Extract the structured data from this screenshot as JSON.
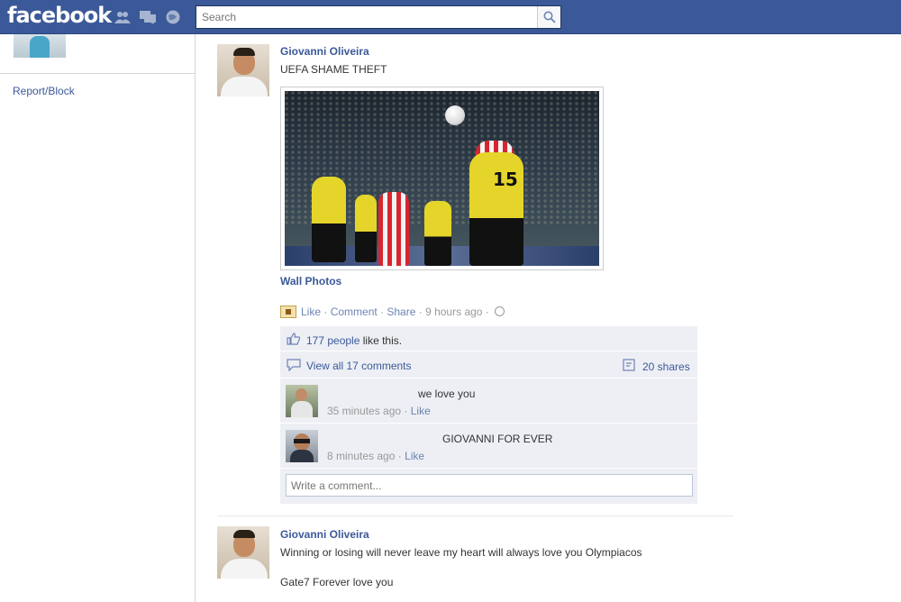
{
  "topbar": {
    "logo": "facebook",
    "search_placeholder": "Search",
    "colors": {
      "bar": "#3b5998",
      "link": "#3b5998"
    },
    "icons": [
      "friend-requests-icon",
      "messages-icon",
      "notifications-icon",
      "search-icon"
    ]
  },
  "sidebar": {
    "report_label": "Report/Block"
  },
  "post1": {
    "author": "Giovanni Oliveira",
    "text": "UEFA SHAME THEFT",
    "photo_album": "Wall Photos",
    "actions": {
      "like": "Like",
      "comment": "Comment",
      "share": "Share",
      "time": "9 hours ago"
    },
    "likes": {
      "count_link": "177 people",
      "suffix": "like this."
    },
    "view_comments": "View all 17 comments",
    "shares": "20 shares",
    "comments": [
      {
        "text": "we love you",
        "time": "35 minutes ago",
        "like": "Like"
      },
      {
        "text": "GIOVANNI FOR EVER",
        "time": "8 minutes ago",
        "like": "Like"
      }
    ],
    "write_placeholder": "Write a comment..."
  },
  "post2": {
    "author": "Giovanni Oliveira",
    "line1": "Winning or losing will never leave my heart will always love you Olympiacos",
    "line2": "Gate7 Forever love you"
  }
}
